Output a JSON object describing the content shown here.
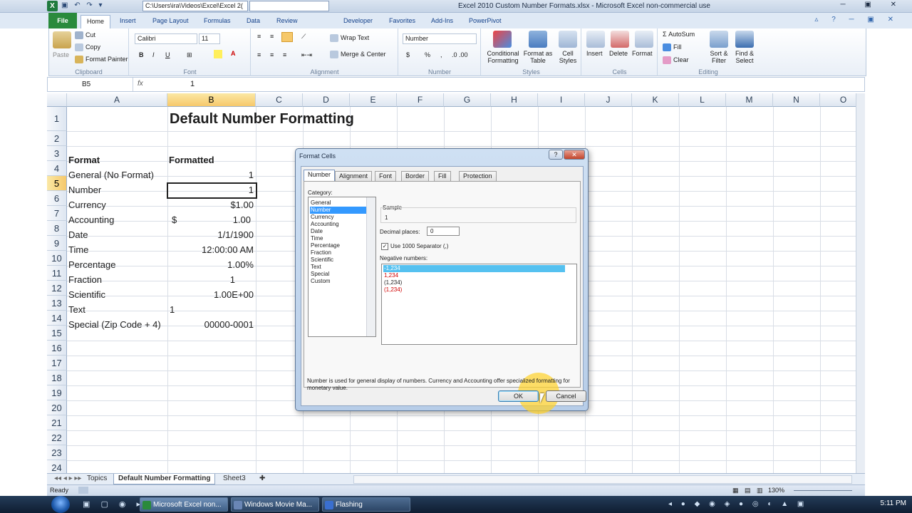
{
  "titlebar": {
    "qat_icons": "▣ ↶ ↷ ▾",
    "path": "C:\\Users\\ira\\Videos\\Excel\\Excel 2(",
    "title": "Excel 2010 Custom Number Formats.xlsx - Microsoft Excel non-commercial use",
    "window_buttons": "─ ▣ ✕"
  },
  "tabs": [
    "File",
    "Home",
    "Insert",
    "Page Layout",
    "Formulas",
    "Data",
    "Review",
    "Developer",
    "Favorites",
    "Add-Ins",
    "PowerPivot"
  ],
  "active_tab": "Home",
  "ribbon": {
    "clipboard": {
      "paste": "Paste",
      "cut": "Cut",
      "copy": "Copy",
      "format_painter": "Format Painter",
      "label": "Clipboard"
    },
    "font": {
      "name": "Calibri",
      "size": "11",
      "bold": "B",
      "italic": "I",
      "underline": "U",
      "label": "Font"
    },
    "alignment": {
      "wrap": "Wrap Text",
      "merge": "Merge & Center",
      "label": "Alignment"
    },
    "number": {
      "format": "Number",
      "currency": "$",
      "percent": "%",
      "comma": ",",
      "label": "Number"
    },
    "styles": {
      "conditional": "Conditional Formatting",
      "format_table": "Format as Table",
      "cell_styles": "Cell Styles",
      "label": "Styles"
    },
    "cells": {
      "insert": "Insert",
      "delete": "Delete",
      "format": "Format",
      "label": "Cells"
    },
    "editing": {
      "autosum": "AutoSum",
      "fill": "Fill",
      "clear": "Clear",
      "sort": "Sort & Filter",
      "find": "Find & Select",
      "label": "Editing"
    }
  },
  "formula_bar": {
    "name_box": "B5",
    "fx": "fx",
    "value": "1"
  },
  "columns": [
    "A",
    "B",
    "C",
    "D",
    "E",
    "F",
    "G",
    "H",
    "I",
    "J",
    "K",
    "L",
    "M",
    "N",
    "O"
  ],
  "rows": [
    "1",
    "2",
    "3",
    "4",
    "5",
    "6",
    "7",
    "8",
    "9",
    "10",
    "11",
    "12",
    "13",
    "14",
    "15",
    "16",
    "17",
    "18",
    "19",
    "20",
    "21",
    "22",
    "23",
    "24"
  ],
  "sheet": {
    "title": "Default Number Formatting",
    "header_format": "Format",
    "header_formatted": "Formatted",
    "items": [
      {
        "format": "General (No Format)",
        "value": "1"
      },
      {
        "format": "Number",
        "value": "1"
      },
      {
        "format": "Currency",
        "value": "$1.00"
      },
      {
        "format": "Accounting",
        "symbol": "$",
        "value": "1.00"
      },
      {
        "format": "Date",
        "value": "1/1/1900"
      },
      {
        "format": "Time",
        "value": "12:00:00 AM"
      },
      {
        "format": "Percentage",
        "value": "1.00%"
      },
      {
        "format": "Fraction",
        "value": "1"
      },
      {
        "format": "Scientific",
        "value": "1.00E+00"
      },
      {
        "format": "Text",
        "value": "1"
      },
      {
        "format": "Special (Zip Code + 4)",
        "value": "00000-0001"
      }
    ]
  },
  "sheet_tabs": [
    "Topics",
    "Default Number Formatting",
    "Sheet3"
  ],
  "active_sheet": "Default Number Formatting",
  "status": {
    "ready": "Ready",
    "zoom": "130%"
  },
  "dialog": {
    "title": "Format Cells",
    "help": "?",
    "close": "✕",
    "tabs": [
      "Number",
      "Alignment",
      "Font",
      "Border",
      "Fill",
      "Protection"
    ],
    "active_tab": "Number",
    "category_label": "Category:",
    "categories": [
      "General",
      "Number",
      "Currency",
      "Accounting",
      "Date",
      "Time",
      "Percentage",
      "Fraction",
      "Scientific",
      "Text",
      "Special",
      "Custom"
    ],
    "selected_category": "Number",
    "sample_label": "Sample",
    "sample_value": "1",
    "decimal_label": "Decimal places:",
    "decimal_value": "0",
    "separator_label": "Use 1000 Separator (,)",
    "separator_checked": true,
    "negative_label": "Negative numbers:",
    "negative_options": [
      {
        "text": "-1,234",
        "selected": true,
        "red": false
      },
      {
        "text": "1,234",
        "selected": false,
        "red": true
      },
      {
        "text": "(1,234)",
        "selected": false,
        "red": false
      },
      {
        "text": "(1,234)",
        "selected": false,
        "red": true
      }
    ],
    "description": "Number is used for general display of numbers.  Currency and Accounting offer specialized formatting for monetary value.",
    "ok": "OK",
    "cancel": "Cancel"
  },
  "taskbar": {
    "buttons": [
      "Microsoft Excel non...",
      "Windows Movie Ma...",
      "Flashing"
    ],
    "clock": "5:11 PM"
  },
  "colors": {
    "accent": "#2a8a3c",
    "selection": "#3399ff",
    "highlight": "#f6c86a"
  }
}
